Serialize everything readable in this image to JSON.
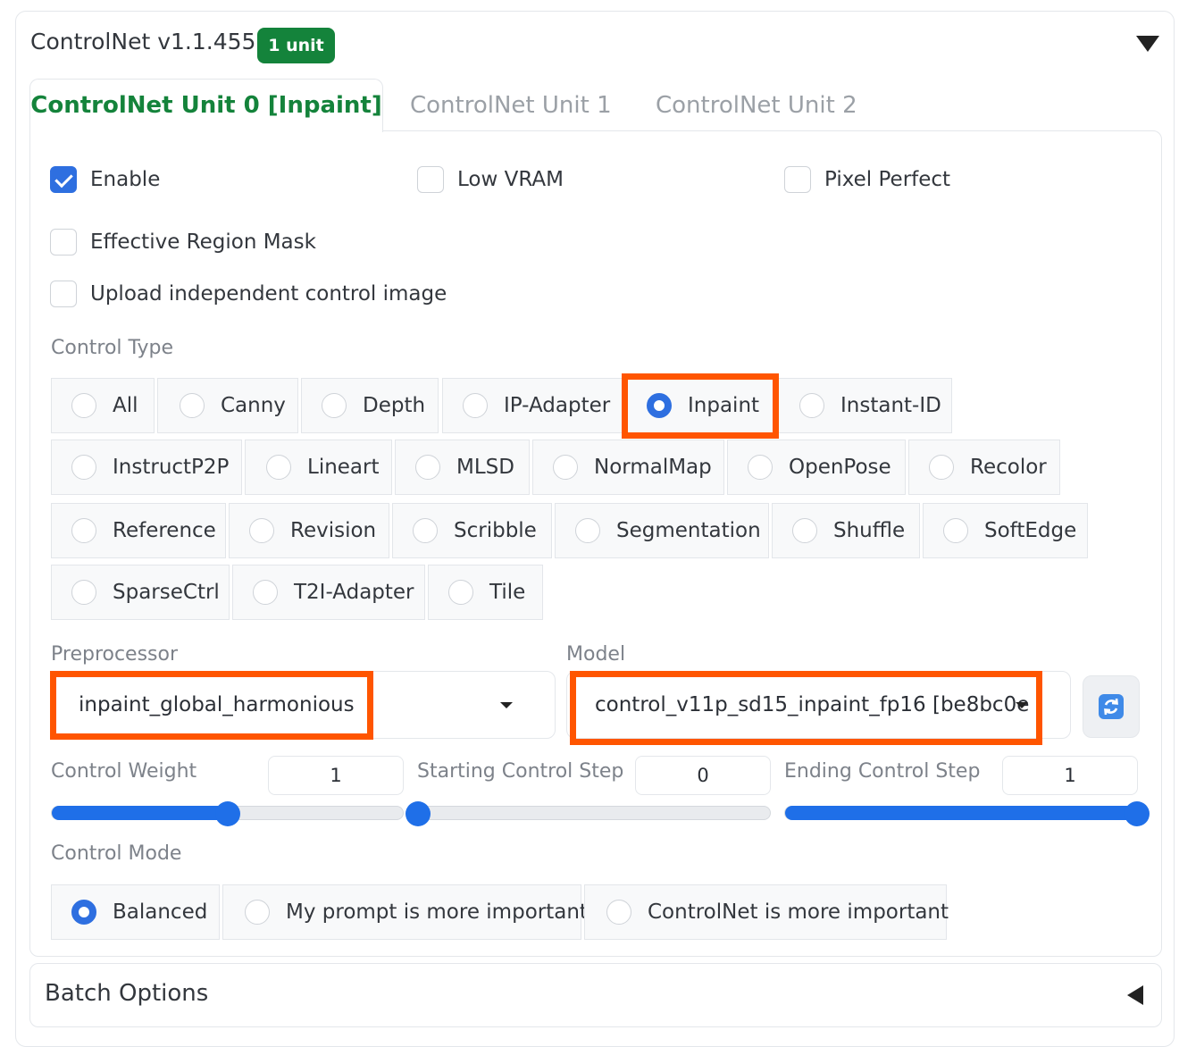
{
  "header": {
    "title": "ControlNet v1.1.455",
    "badge": "1 unit"
  },
  "tabs": [
    {
      "label": "ControlNet Unit 0 [Inpaint]",
      "active": true
    },
    {
      "label": "ControlNet Unit 1",
      "active": false
    },
    {
      "label": "ControlNet Unit 2",
      "active": false
    }
  ],
  "checkboxes": {
    "enable": {
      "label": "Enable",
      "checked": true
    },
    "low_vram": {
      "label": "Low VRAM",
      "checked": false
    },
    "pixel_perfect": {
      "label": "Pixel Perfect",
      "checked": false
    },
    "effective_region_mask": {
      "label": "Effective Region Mask",
      "checked": false
    },
    "upload_independent": {
      "label": "Upload independent control image",
      "checked": false
    }
  },
  "control_type": {
    "label": "Control Type",
    "selected": "Inpaint",
    "options": [
      "All",
      "Canny",
      "Depth",
      "IP-Adapter",
      "Inpaint",
      "Instant-ID",
      "InstructP2P",
      "Lineart",
      "MLSD",
      "NormalMap",
      "OpenPose",
      "Recolor",
      "Reference",
      "Revision",
      "Scribble",
      "Segmentation",
      "Shuffle",
      "SoftEdge",
      "SparseCtrl",
      "T2I-Adapter",
      "Tile"
    ]
  },
  "preprocessor": {
    "label": "Preprocessor",
    "value": "inpaint_global_harmonious"
  },
  "model": {
    "label": "Model",
    "value": "control_v11p_sd15_inpaint_fp16 [be8bc0e"
  },
  "sliders": {
    "control_weight": {
      "label": "Control Weight",
      "value": "1",
      "fraction": 0.5
    },
    "starting_step": {
      "label": "Starting Control Step",
      "value": "0",
      "fraction": 0.0
    },
    "ending_step": {
      "label": "Ending Control Step",
      "value": "1",
      "fraction": 1.0
    }
  },
  "control_mode": {
    "label": "Control Mode",
    "selected": "Balanced",
    "options": [
      "Balanced",
      "My prompt is more important",
      "ControlNet is more important"
    ]
  },
  "batch": {
    "label": "Batch Options"
  },
  "colors": {
    "accent_green": "#14833b",
    "accent_blue": "#1f6fe8",
    "highlight": "#ff5500"
  },
  "icons": {
    "collapse": "caret-down-icon",
    "refresh": "refresh-icon",
    "expand": "caret-left-icon"
  }
}
